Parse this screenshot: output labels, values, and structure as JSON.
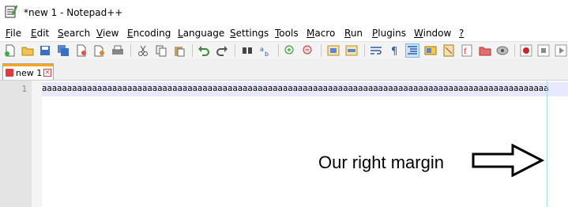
{
  "window": {
    "title": "*new 1 - Notepad++"
  },
  "menu": [
    {
      "mnemonic": "F",
      "rest": "ile"
    },
    {
      "mnemonic": "E",
      "rest": "dit"
    },
    {
      "mnemonic": "S",
      "rest": "earch"
    },
    {
      "mnemonic": "V",
      "rest": "iew"
    },
    {
      "mnemonic": "E",
      "rest": "ncoding"
    },
    {
      "mnemonic": "L",
      "rest": "anguage"
    },
    {
      "mnemonic": "S",
      "rest": "ettings"
    },
    {
      "mnemonic": "T",
      "rest": "ools"
    },
    {
      "mnemonic": "M",
      "rest": "acro"
    },
    {
      "mnemonic": "R",
      "rest": "un"
    },
    {
      "mnemonic": "P",
      "rest": "lugins"
    },
    {
      "mnemonic": "W",
      "rest": "indow"
    },
    {
      "mnemonic": "?",
      "rest": ""
    }
  ],
  "toolbar": {
    "icons": [
      "new-file-icon",
      "open-file-icon",
      "save-icon",
      "save-all-icon",
      "close-icon",
      "close-all-icon",
      "print-icon",
      "cut-icon",
      "copy-icon",
      "paste-icon",
      "undo-icon",
      "redo-icon",
      "find-icon",
      "replace-icon",
      "zoom-in-icon",
      "zoom-out-icon",
      "sync-vertical-icon",
      "sync-horizontal-icon",
      "word-wrap-icon",
      "show-all-chars-icon",
      "indent-guide-icon",
      "user-language-icon",
      "document-map-icon",
      "function-list-icon",
      "folder-workspace-icon",
      "monitoring-icon",
      "record-macro-icon",
      "stop-macro-icon"
    ]
  },
  "tabs": [
    {
      "label": "new 1"
    }
  ],
  "editor": {
    "line_number": "1",
    "line_text": "aaaaaaaaaaaaaaaaaaaaaaaaaaaaaaaaaaaaaaaaaaaaaaaaaaaaaaaaaaaaaaaaaaaaaaaaaaaaaaaaaaaaaaaaaaaaaaaaaaaaa"
  },
  "annotation": {
    "text": "Our right margin"
  },
  "colors": {
    "current_line": "#e8e8ff",
    "edge_line": "#a6dcee",
    "tab_accent": "#f5a623"
  }
}
